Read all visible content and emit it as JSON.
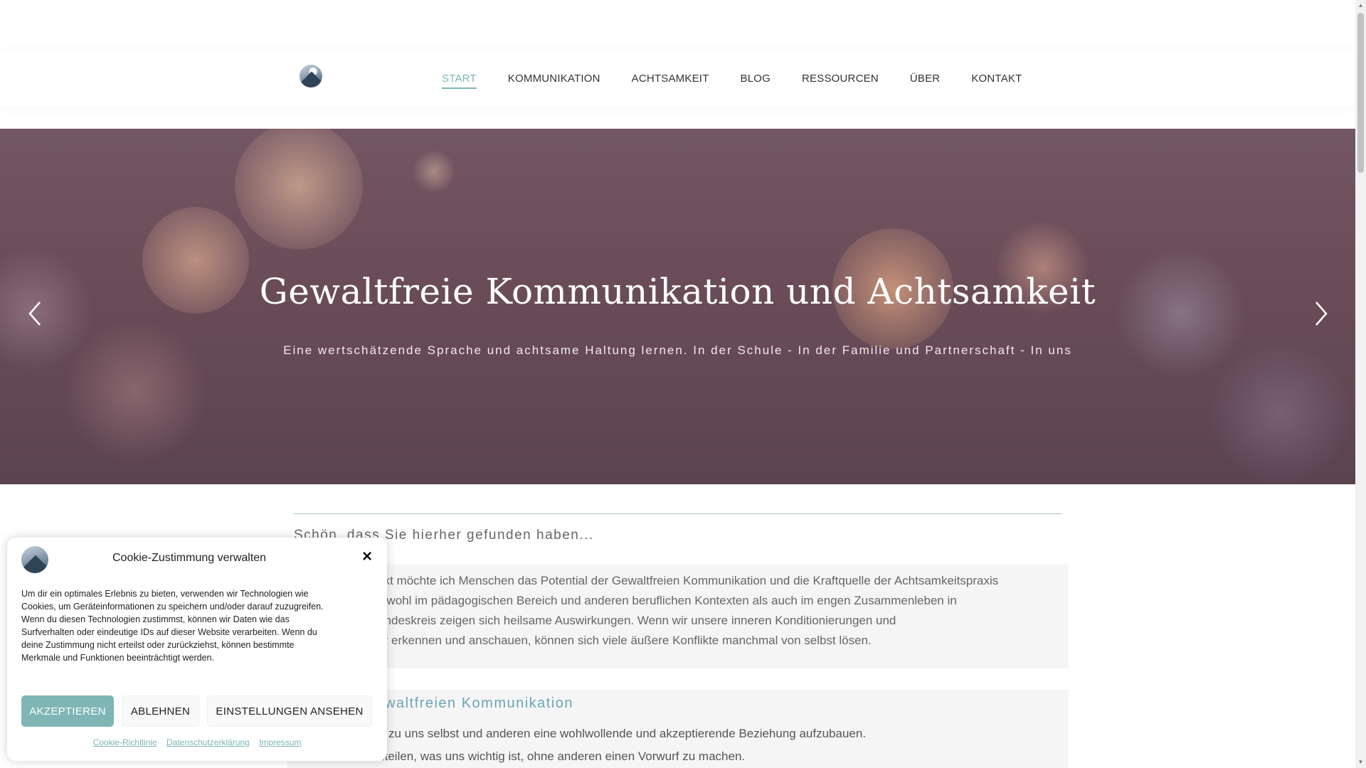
{
  "nav": {
    "items": [
      {
        "label": "START",
        "active": true
      },
      {
        "label": "KOMMUNIKATION"
      },
      {
        "label": "ACHTSAMKEIT"
      },
      {
        "label": "BLOG"
      },
      {
        "label": "RESSOURCEN"
      },
      {
        "label": "ÜBER"
      },
      {
        "label": "KONTAKT"
      }
    ]
  },
  "hero": {
    "title": "Gewaltfreie Kommunikation und Achtsamkeit",
    "subtitle": "Eine wertschätzende Sprache und achtsame Haltung lernen. In der Schule - In der Familie und Partnerschaft - In uns"
  },
  "content": {
    "intro_heading": "Schön, dass Sie hierher gefunden haben...",
    "intro_lines": [
      "Mit diesem Projekt möchte ich Menschen das Potential der Gewaltfreien Kommunikation und die Kraftquelle der Achtsamkeitspraxis",
      "näherbringen. Sowohl im pädagogischen Bereich und anderen beruflichen Kontexten als auch im engen Zusammenleben in",
      "Familie und Freundeskreis zeigen sich heilsame Auswirkungen. Wenn wir unsere inneren Konditionierungen und",
      "Verhaltensmuster erkennen und anschauen, können sich viele äußere Konflikte manchmal von selbst lösen."
    ],
    "section_heading": "Ziele der Gewaltfreien Kommunikation",
    "section_lines": [
      "zu uns selbst und anderen eine wohlwollende und akzeptierende Beziehung aufzubauen.",
      "mitzuteilen, was uns wichtig ist, ohne anderen einen Vorwurf zu machen."
    ]
  },
  "cookie": {
    "title": "Cookie-Zustimmung verwalten",
    "close_icon": "×",
    "text": "Um dir ein optimales Erlebnis zu bieten, verwenden wir Technologien wie Cookies, um Geräteinformationen zu speichern und/oder darauf zuzugreifen. Wenn du diesen Technologien zustimmst, können wir Daten wie das Surfverhalten oder eindeutige IDs auf dieser Website verarbeiten. Wenn du deine Zustimmung nicht erteilst oder zurückziehst, können bestimmte Merkmale und Funktionen beeinträchtigt werden.",
    "accept": "AKZEPTIEREN",
    "deny": "ABLEHNEN",
    "settings": "EINSTELLUNGEN ANSEHEN",
    "links": [
      "Cookie-Richtlinie",
      "Datenschutzerklärung",
      "Impressum"
    ]
  },
  "colors": {
    "accent": "#7fb5b5",
    "heading_blue": "#6aa4b8",
    "hero_base": "#6a4c58"
  }
}
